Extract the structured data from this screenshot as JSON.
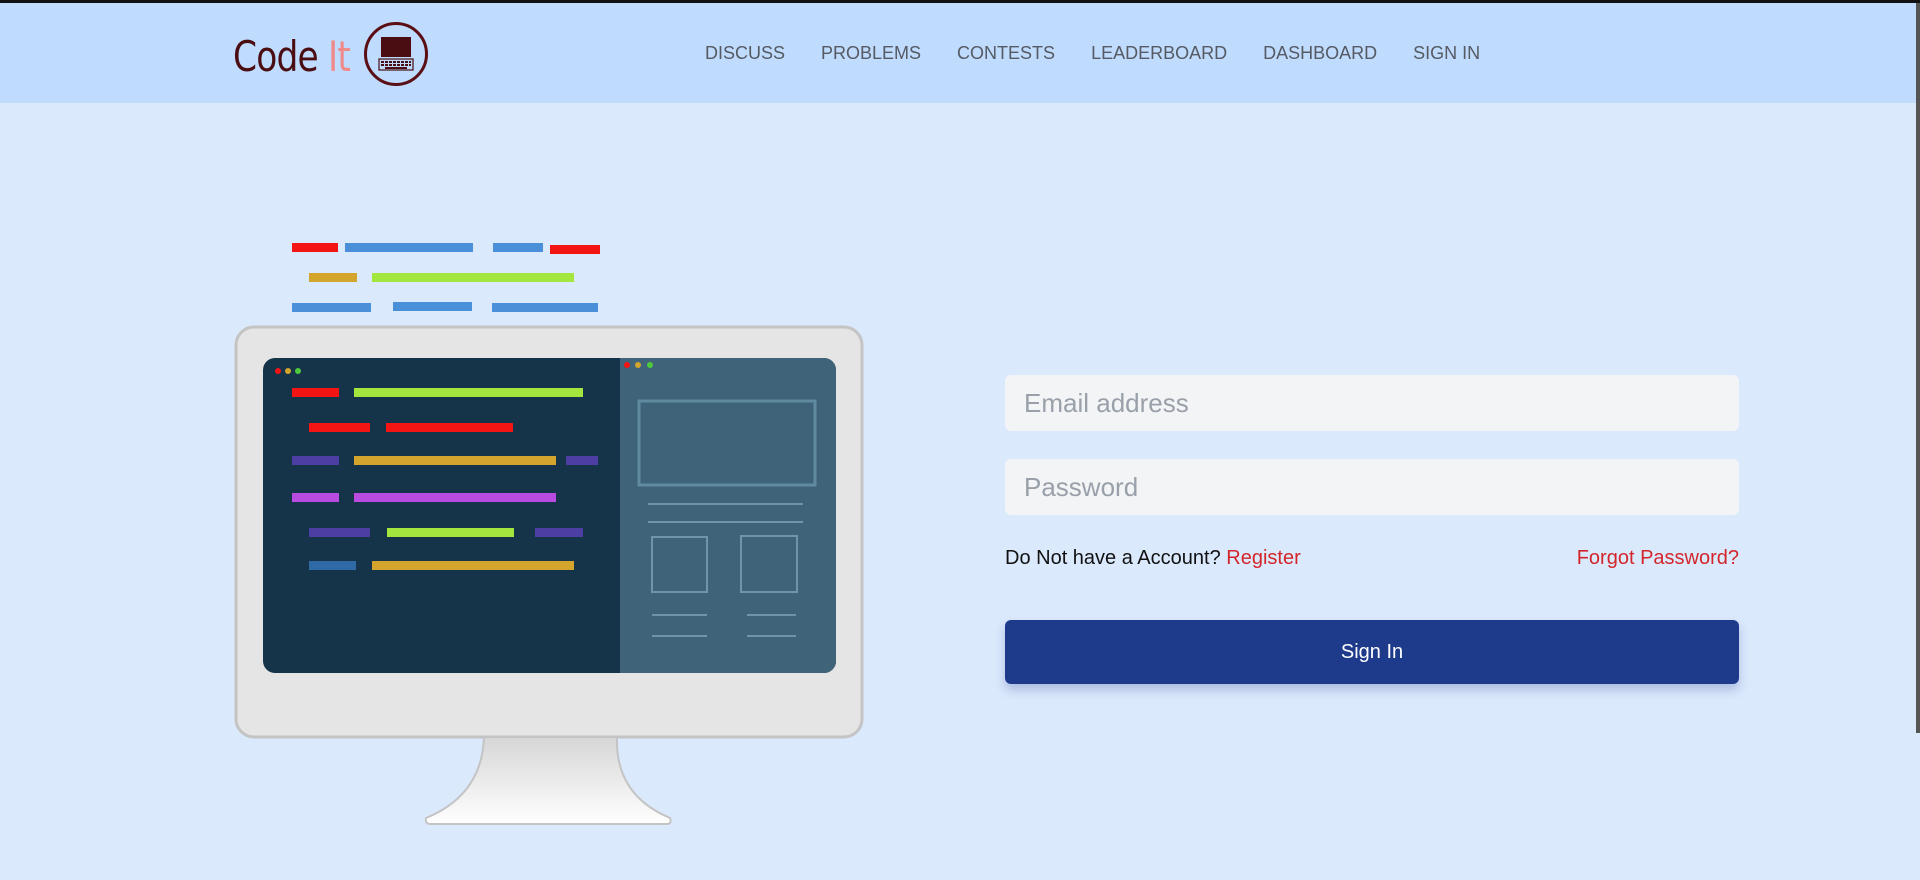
{
  "brand": {
    "name_primary": "Code",
    "name_accent": "It",
    "accent_color": "#f08a8a",
    "primary_color": "#4a0d12",
    "icon": "computer-icon"
  },
  "nav": {
    "items": [
      "DISCUSS",
      "PROBLEMS",
      "CONTESTS",
      "LEADERBOARD",
      "DASHBOARD",
      "SIGN IN"
    ]
  },
  "login": {
    "email_placeholder": "Email address",
    "password_placeholder": "Password",
    "no_account_text": "Do Not have a Account?",
    "register_label": "Register",
    "forgot_label": "Forgot Password?",
    "submit_label": "Sign In",
    "button_color": "#1e3a8a",
    "link_color": "#d3262b"
  },
  "illustration": {
    "icon": "monitor-with-code-icon"
  }
}
